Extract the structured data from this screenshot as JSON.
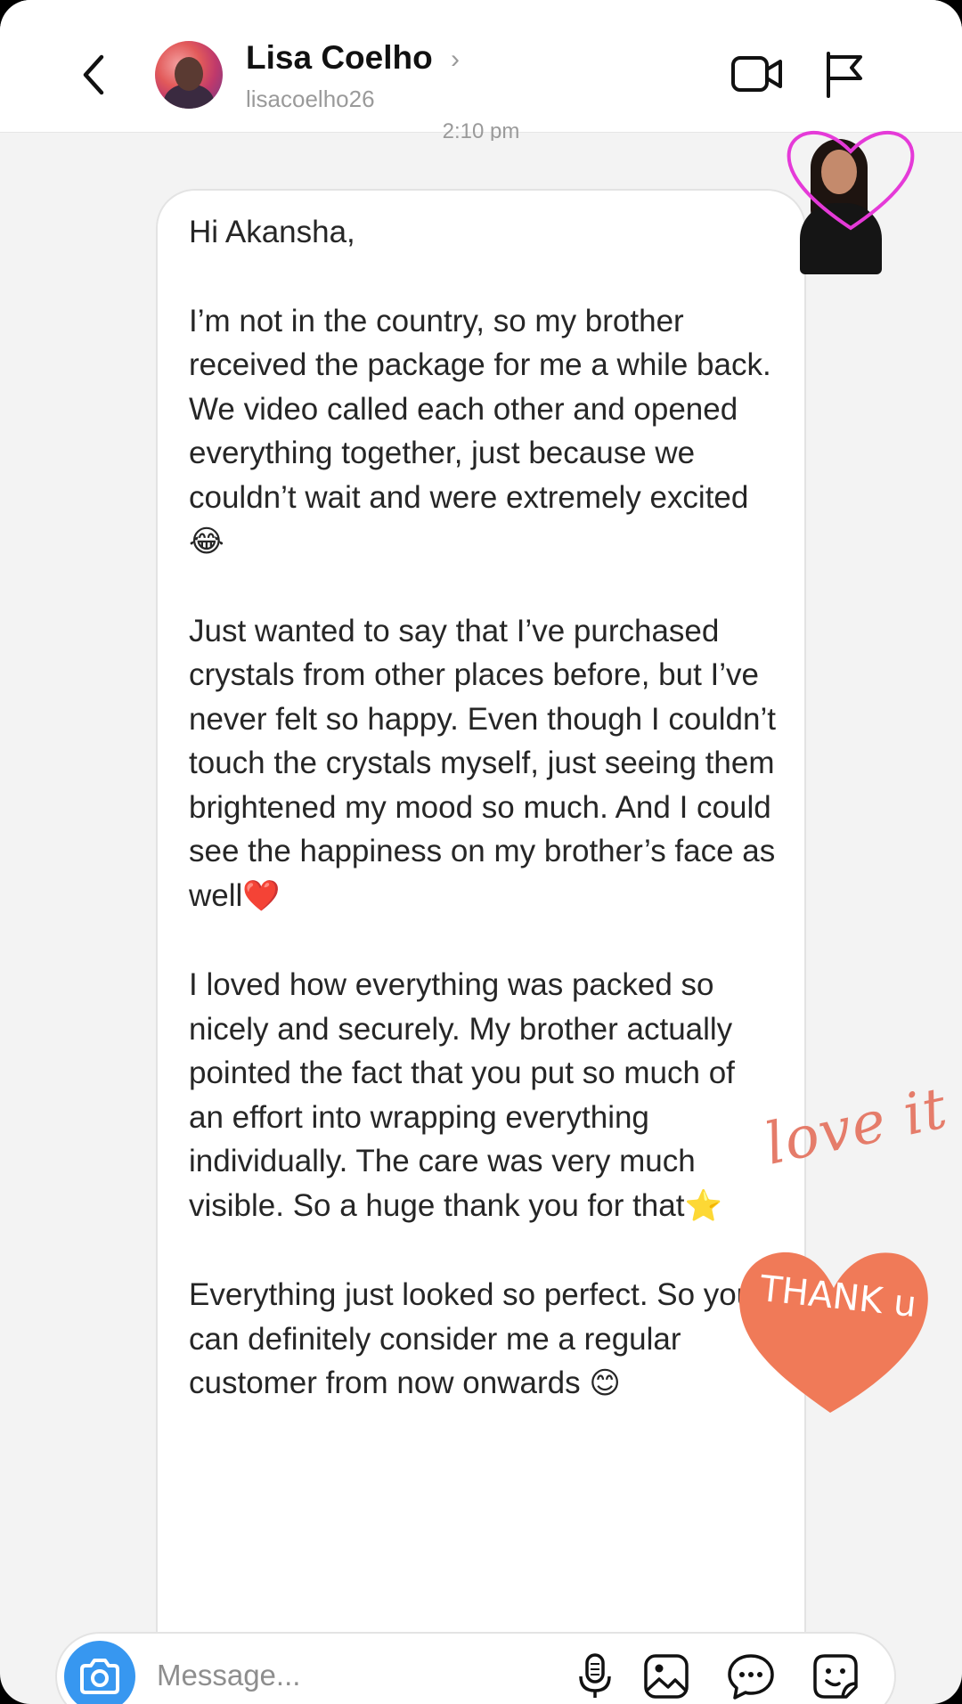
{
  "header": {
    "name": "Lisa Coelho",
    "chevron": "›",
    "username": "lisacoelho26",
    "icons": [
      "back-arrow-icon",
      "video-call-icon",
      "flag-icon"
    ]
  },
  "chat": {
    "timestamp": "2:10 pm",
    "message": {
      "greeting": "Hi Akansha,",
      "para1": "I’m not in the country, so my brother received the package for me a while back. We video called each other and opened everything together, just because we couldn’t wait and were extremely excited",
      "para1_emoji": "😂",
      "para2": "Just wanted to say that I’ve purchased crystals from other places before, but I’ve never felt so happy. Even though I couldn’t touch the crystals myself, just seeing them brightened my mood so much. And I could see the happiness on my brother’s face as well",
      "para2_emoji": "❤️",
      "para3": "I loved how everything was packed so nicely and securely. My brother actually pointed the fact that you put so much of an effort into wrapping everything individually. The care was very much visible. So a huge thank you for that",
      "para3_emoji": "⭐",
      "para4": "Everything just looked so perfect. So you can definitely consider me a regular customer from now onwards",
      "para4_emoji": "😊"
    }
  },
  "stickers": {
    "love_it": "love it",
    "thank_u": "THANK u"
  },
  "composer": {
    "placeholder": "Message...",
    "icons": [
      "camera-icon",
      "microphone-icon",
      "gallery-icon",
      "chat-bubble-icon",
      "sticker-icon"
    ]
  },
  "colors": {
    "accent_blue": "#3797f0",
    "sticker_coral": "#f07a58",
    "heart_magenta": "#e53ad8"
  }
}
